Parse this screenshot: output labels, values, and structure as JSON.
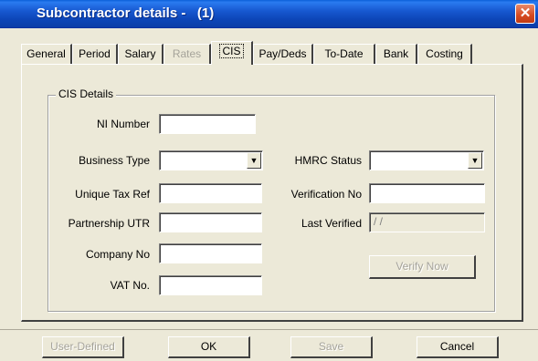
{
  "window": {
    "title": "Subcontractor details -   (1)",
    "close_glyph": "✕"
  },
  "tabs": [
    {
      "label": "General",
      "state": "normal"
    },
    {
      "label": "Period",
      "state": "normal"
    },
    {
      "label": "Salary",
      "state": "normal"
    },
    {
      "label": "Rates",
      "state": "disabled"
    },
    {
      "label": "CIS",
      "state": "active"
    },
    {
      "label": "Pay/Deds",
      "state": "normal"
    },
    {
      "label": "To-Date",
      "state": "normal"
    },
    {
      "label": "Bank",
      "state": "normal"
    },
    {
      "label": "Costing",
      "state": "normal"
    }
  ],
  "cis": {
    "group_title": "CIS Details",
    "ni_number": {
      "label": "NI Number",
      "value": ""
    },
    "business_type": {
      "label": "Business Type",
      "value": ""
    },
    "unique_tax_ref": {
      "label": "Unique Tax Ref",
      "value": ""
    },
    "partnership_utr": {
      "label": "Partnership UTR",
      "value": ""
    },
    "company_no": {
      "label": "Company No",
      "value": ""
    },
    "vat_no": {
      "label": "VAT No.",
      "value": ""
    },
    "hmrc_status": {
      "label": "HMRC Status",
      "value": ""
    },
    "verification_no": {
      "label": "Verification No",
      "value": ""
    },
    "last_verified": {
      "label": "Last Verified",
      "value": " / /"
    },
    "verify_now": "Verify Now"
  },
  "buttons": {
    "user_defined": "User-Defined",
    "ok": "OK",
    "save": "Save",
    "cancel": "Cancel"
  },
  "icons": {
    "dropdown_arrow": "▼"
  }
}
